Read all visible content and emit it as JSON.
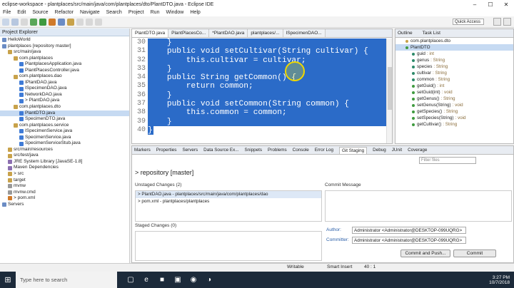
{
  "window": {
    "title": "eclipse-workspace - plantplaces/src/main/java/com/plantplaces/dto/PlantDTO.java - Eclipse IDE"
  },
  "menu": [
    "File",
    "Edit",
    "Source",
    "Refactor",
    "Navigate",
    "Search",
    "Project",
    "Run",
    "Window",
    "Help"
  ],
  "quick_access": "Quick Access",
  "explorer": {
    "tab": "Project Explorer",
    "rows": [
      {
        "label": "HelloWorld",
        "indent": 0,
        "icon": "#6b8cc4"
      },
      {
        "label": "plantplaces [repository master]",
        "indent": 0,
        "icon": "#6b8cc4"
      },
      {
        "label": "src/main/java",
        "indent": 1,
        "icon": "#c8a24a"
      },
      {
        "label": "com.plantplaces",
        "indent": 2,
        "icon": "#c8a24a"
      },
      {
        "label": "PlantplacesApplication.java",
        "indent": 3,
        "icon": "#3f7bd6"
      },
      {
        "label": "PlantPlacesController.java",
        "indent": 3,
        "icon": "#3f7bd6"
      },
      {
        "label": "com.plantplaces.dao",
        "indent": 2,
        "icon": "#c8a24a"
      },
      {
        "label": "IPlantDAO.java",
        "indent": 3,
        "icon": "#3f7bd6"
      },
      {
        "label": "ISpecimenDAO.java",
        "indent": 3,
        "icon": "#3f7bd6"
      },
      {
        "label": "NetworkDAO.java",
        "indent": 3,
        "icon": "#3f7bd6"
      },
      {
        "label": "> PlantDAO.java",
        "indent": 3,
        "icon": "#3f7bd6"
      },
      {
        "label": "com.plantplaces.dto",
        "indent": 2,
        "icon": "#c8a24a"
      },
      {
        "label": "PlantDTO.java",
        "indent": 3,
        "icon": "#3f7bd6",
        "selected": true
      },
      {
        "label": "SpecimenDTO.java",
        "indent": 3,
        "icon": "#3f7bd6"
      },
      {
        "label": "com.plantplaces.service",
        "indent": 2,
        "icon": "#c8a24a"
      },
      {
        "label": "ISpecimenService.java",
        "indent": 3,
        "icon": "#3f7bd6"
      },
      {
        "label": "SpecimenService.java",
        "indent": 3,
        "icon": "#3f7bd6"
      },
      {
        "label": "SpecimenServiceStub.java",
        "indent": 3,
        "icon": "#3f7bd6"
      },
      {
        "label": "src/main/resources",
        "indent": 1,
        "icon": "#c8a24a"
      },
      {
        "label": "src/test/java",
        "indent": 1,
        "icon": "#c8a24a"
      },
      {
        "label": "JRE System Library [JavaSE-1.8]",
        "indent": 1,
        "icon": "#8c6fb0"
      },
      {
        "label": "Maven Dependencies",
        "indent": 1,
        "icon": "#8c6fb0"
      },
      {
        "label": "> src",
        "indent": 1,
        "icon": "#c8a24a"
      },
      {
        "label": "target",
        "indent": 1,
        "icon": "#c8a24a"
      },
      {
        "label": "mvnw",
        "indent": 1,
        "icon": "#999999"
      },
      {
        "label": "mvnw.cmd",
        "indent": 1,
        "icon": "#999999"
      },
      {
        "label": "> pom.xml",
        "indent": 1,
        "icon": "#d07a2a"
      },
      {
        "label": "Servers",
        "indent": 0,
        "icon": "#6b8cc4"
      }
    ]
  },
  "editor": {
    "tabs": [
      "PlantDTO.java",
      "PlantPlacesCo...",
      "*PlantDAO.java",
      "plantplaces/...",
      "ISpecimenDAO..."
    ],
    "active_tab": 0,
    "lines": [
      {
        "n": "30",
        "code": "    }"
      },
      {
        "n": "31",
        "code": "    public void setCultivar(String cultivar) {"
      },
      {
        "n": "32",
        "code": "        this.cultivar = cultivar;"
      },
      {
        "n": "33",
        "code": "    }"
      },
      {
        "n": "34",
        "code": "    public String getCommon() {"
      },
      {
        "n": "35",
        "code": "        return common;"
      },
      {
        "n": "36",
        "code": "    }"
      },
      {
        "n": "37",
        "code": "    public void setCommon(String common) {"
      },
      {
        "n": "38",
        "code": "        this.common = common;"
      },
      {
        "n": "39",
        "code": "    }"
      },
      {
        "n": "40",
        "code": "}"
      }
    ]
  },
  "outline": {
    "tabs": [
      "Outline",
      "Task List"
    ],
    "rows": [
      {
        "label": "com.plantplaces.dto",
        "type": "",
        "indent": 0,
        "color": "#c8a24a"
      },
      {
        "label": "PlantDTO",
        "type": "",
        "indent": 0,
        "color": "#3f9a3f",
        "selected": true
      },
      {
        "label": "guid",
        "type": ": int",
        "indent": 1,
        "color": "#2c8a6a"
      },
      {
        "label": "genus",
        "type": ": String",
        "indent": 1,
        "color": "#2c8a6a"
      },
      {
        "label": "species",
        "type": ": String",
        "indent": 1,
        "color": "#2c8a6a"
      },
      {
        "label": "cultivar",
        "type": ": String",
        "indent": 1,
        "color": "#2c8a6a"
      },
      {
        "label": "common",
        "type": ": String",
        "indent": 1,
        "color": "#2c8a6a"
      },
      {
        "label": "getGuid()",
        "type": ": int",
        "indent": 1,
        "color": "#3f9a3f"
      },
      {
        "label": "setGuid(int)",
        "type": ": void",
        "indent": 1,
        "color": "#3f9a3f"
      },
      {
        "label": "getGenus()",
        "type": ": String",
        "indent": 1,
        "color": "#3f9a3f"
      },
      {
        "label": "setGenus(String)",
        "type": ": void",
        "indent": 1,
        "color": "#3f9a3f"
      },
      {
        "label": "getSpecies()",
        "type": ": String",
        "indent": 1,
        "color": "#3f9a3f"
      },
      {
        "label": "setSpecies(String)",
        "type": ": void",
        "indent": 1,
        "color": "#3f9a3f"
      },
      {
        "label": "getCultivar()",
        "type": ": String",
        "indent": 1,
        "color": "#3f9a3f"
      }
    ]
  },
  "bottom": {
    "tabs": [
      "Markers",
      "Properties",
      "Servers",
      "Data Source Ex...",
      "Snippets",
      "Problems",
      "Console",
      "Error Log",
      "Git Staging",
      "Debug",
      "JUnit",
      "Coverage"
    ],
    "active_tab": 8,
    "filter_placeholder": "Filter files",
    "repository": "> repository [master]",
    "unstaged_label": "Unstaged Changes (2)",
    "unstaged": [
      "> PlantDAO.java - plantplaces/src/main/java/com/plantplaces/dao",
      "> pom.xml - plantplaces/plantplaces"
    ],
    "staged_label": "Staged Changes (0)",
    "commit_message_label": "Commit Message",
    "author_label": "Author:",
    "author": "Administrator <Administrator@DESKTOP-099UQRG>",
    "committer_label": "Committer:",
    "committer": "Administrator <Administrator@DESKTOP-099UQRG>",
    "commit_push": "Commit and Push...",
    "commit": "Commit"
  },
  "status": {
    "writable": "Writable",
    "insert": "Smart Insert",
    "position": "40 : 1"
  },
  "taskbar": {
    "search": "Type here to search",
    "time": "3:27 PM",
    "date": "10/7/2018"
  }
}
